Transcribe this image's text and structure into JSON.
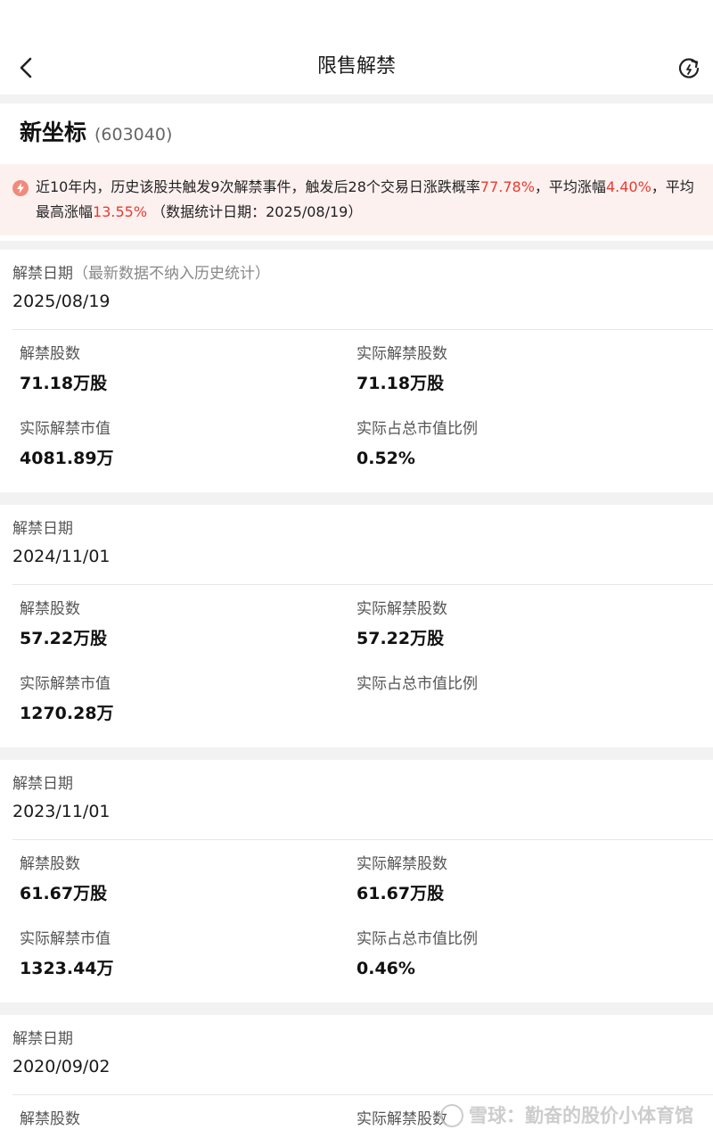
{
  "header": {
    "title": "限售解禁",
    "back_icon": "chevron-left-icon",
    "refresh_icon": "refresh-icon"
  },
  "stock": {
    "name": "新坐标",
    "code": "(603040)"
  },
  "notice": {
    "part1": "近10年内，历史该股共触发9次解禁事件，触发后28个交易日涨跌概率",
    "prob": "77.78%",
    "part2": "，平均涨幅",
    "avg_gain": "4.40%",
    "part3": "，平均最高涨幅",
    "avg_max_gain": "13.55%",
    "part4": " （数据统计日期：2025/08/19）",
    "accent_color": "#e83b2f"
  },
  "labels": {
    "date": "解禁日期",
    "date_note": "（最新数据不纳入历史统计）",
    "shares": "解禁股数",
    "actual_shares": "实际解禁股数",
    "actual_value": "实际解禁市值",
    "actual_ratio": "实际占总市值比例"
  },
  "events": [
    {
      "date": "2025/08/19",
      "shares": "71.18万股",
      "actual_shares": "71.18万股",
      "actual_value": "4081.89万",
      "actual_ratio": "0.52%"
    },
    {
      "date": "2024/11/01",
      "shares": "57.22万股",
      "actual_shares": "57.22万股",
      "actual_value": "1270.28万",
      "actual_ratio": ""
    },
    {
      "date": "2023/11/01",
      "shares": "61.67万股",
      "actual_shares": "61.67万股",
      "actual_value": "1323.44万",
      "actual_ratio": "0.46%"
    },
    {
      "date": "2020/09/02"
    }
  ],
  "watermark": {
    "text": "雪球：勤奋的股价小体育馆"
  }
}
